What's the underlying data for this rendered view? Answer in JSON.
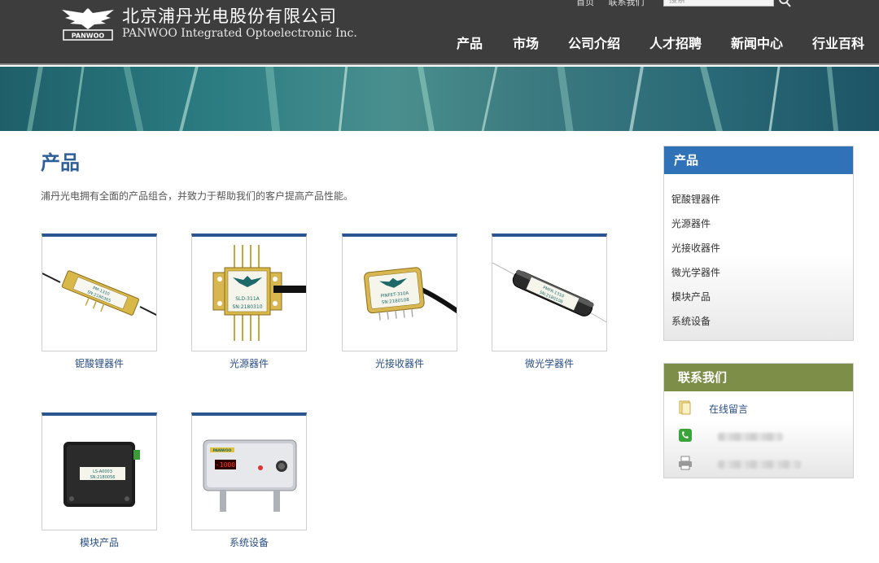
{
  "header": {
    "company_cn": "北京浦丹光电股份有限公司",
    "company_en": "PANWOO Integrated Optoelectronic Inc.",
    "logo_text": "PANWOO",
    "top_links": [
      "首页",
      "联系我们"
    ],
    "search_placeholder": "搜索"
  },
  "nav": [
    "产品",
    "市场",
    "公司介绍",
    "人才招聘",
    "新闻中心",
    "行业百科"
  ],
  "main": {
    "title": "产品",
    "description": "浦丹光电拥有全面的产品组合，并致力于帮助我们的客户提高产品性能。",
    "products": [
      {
        "label": "铌酸锂器件",
        "device_text": [
          "PM-1310",
          "SN:2180365"
        ]
      },
      {
        "label": "光源器件",
        "device_text": [
          "SLD-311A",
          "SN:2180310"
        ]
      },
      {
        "label": "光接收器件",
        "device_text": [
          "PINFET-310A",
          "SN:2180108"
        ]
      },
      {
        "label": "微光学器件",
        "device_text": [
          "PMFR-1310",
          "SN:2180108"
        ]
      },
      {
        "label": "模块产品",
        "device_text": [
          "LS-A0003",
          "SN:2180056"
        ]
      },
      {
        "label": "系统设备",
        "device_text": [
          "-1000",
          "PANWOO"
        ]
      }
    ]
  },
  "sidebar": {
    "title": "产品",
    "items": [
      "铌酸锂器件",
      "光源器件",
      "光接收器件",
      "微光学器件",
      "模块产品",
      "系统设备"
    ]
  },
  "contact": {
    "title": "联系我们",
    "online_message": "在线留言",
    "icons": [
      "note-icon",
      "phone-icon",
      "printer-icon"
    ]
  },
  "colors": {
    "header_bg": "#3d3d3d",
    "title_blue": "#2f5f9a",
    "card_accent": "#2a5590",
    "sidebar_head": "#3072b8",
    "contact_head": "#7d8e48"
  }
}
